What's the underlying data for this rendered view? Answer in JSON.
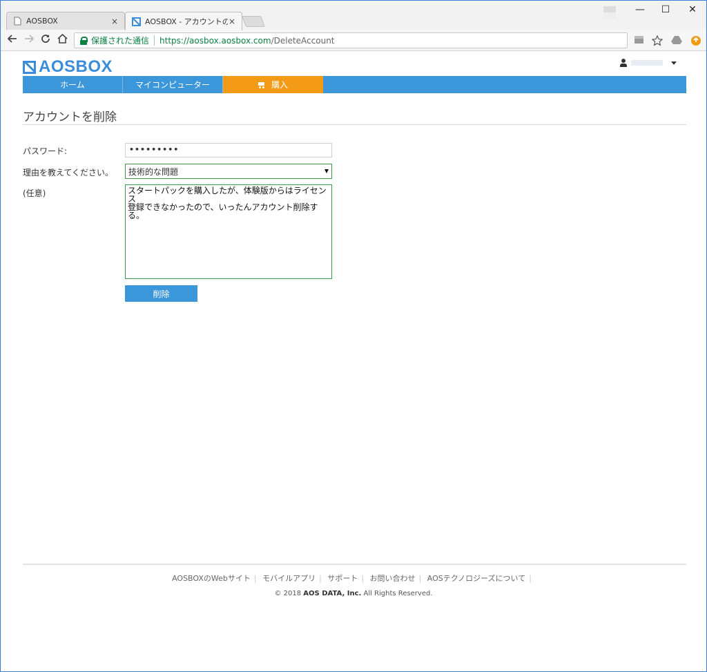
{
  "browser": {
    "tabs": [
      {
        "title": "AOSBOX",
        "close": "×"
      },
      {
        "title": "AOSBOX - アカウントの削除",
        "close": "×"
      }
    ],
    "window_controls": {
      "minimize": "—",
      "maximize": "☐",
      "close": "✕"
    },
    "secure_label": "保護された通信",
    "url_host": "https://aosbox.aosbox.com",
    "url_path": "/DeleteAccount"
  },
  "site": {
    "logo_text": "AOSBOX",
    "nav": [
      {
        "label": "ホーム"
      },
      {
        "label": "マイコンピューター"
      },
      {
        "label": "購入",
        "active": true
      }
    ]
  },
  "page": {
    "title": "アカウントを削除",
    "password_label": "パスワード:",
    "password_value": "•••••••••",
    "reason_label": "理由を教えてください。",
    "reason_selected": "技術的な問題",
    "comment_label": "(任意)",
    "comment_value": "スタートパックを購入したが、体験版からはライセンス\n登録できなかったので、いったんアカウント削除する。",
    "delete_button": "削除"
  },
  "footer": {
    "links": [
      "AOSBOXのWebサイト",
      "モバイルアプリ",
      "サポート",
      "お問い合わせ",
      "AOSテクノロジーズについて"
    ],
    "copyright_prefix": "© 2018 ",
    "copyright_company": "AOS DATA, Inc.",
    "copyright_suffix": " All Rights Reserved."
  },
  "colors": {
    "accent_blue": "#3b97d9",
    "active_orange": "#f39a16",
    "secure_green": "#0b8043"
  }
}
